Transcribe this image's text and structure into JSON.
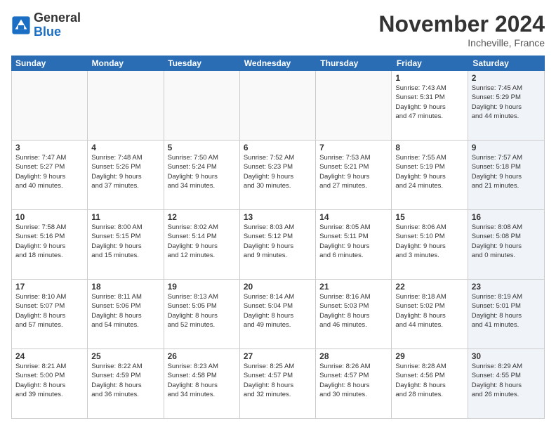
{
  "logo": {
    "text_general": "General",
    "text_blue": "Blue"
  },
  "title": "November 2024",
  "location": "Incheville, France",
  "header_days": [
    "Sunday",
    "Monday",
    "Tuesday",
    "Wednesday",
    "Thursday",
    "Friday",
    "Saturday"
  ],
  "weeks": [
    [
      {
        "day": "",
        "info": ""
      },
      {
        "day": "",
        "info": ""
      },
      {
        "day": "",
        "info": ""
      },
      {
        "day": "",
        "info": ""
      },
      {
        "day": "",
        "info": ""
      },
      {
        "day": "1",
        "info": "Sunrise: 7:43 AM\nSunset: 5:31 PM\nDaylight: 9 hours\nand 47 minutes."
      },
      {
        "day": "2",
        "info": "Sunrise: 7:45 AM\nSunset: 5:29 PM\nDaylight: 9 hours\nand 44 minutes."
      }
    ],
    [
      {
        "day": "3",
        "info": "Sunrise: 7:47 AM\nSunset: 5:27 PM\nDaylight: 9 hours\nand 40 minutes."
      },
      {
        "day": "4",
        "info": "Sunrise: 7:48 AM\nSunset: 5:26 PM\nDaylight: 9 hours\nand 37 minutes."
      },
      {
        "day": "5",
        "info": "Sunrise: 7:50 AM\nSunset: 5:24 PM\nDaylight: 9 hours\nand 34 minutes."
      },
      {
        "day": "6",
        "info": "Sunrise: 7:52 AM\nSunset: 5:23 PM\nDaylight: 9 hours\nand 30 minutes."
      },
      {
        "day": "7",
        "info": "Sunrise: 7:53 AM\nSunset: 5:21 PM\nDaylight: 9 hours\nand 27 minutes."
      },
      {
        "day": "8",
        "info": "Sunrise: 7:55 AM\nSunset: 5:19 PM\nDaylight: 9 hours\nand 24 minutes."
      },
      {
        "day": "9",
        "info": "Sunrise: 7:57 AM\nSunset: 5:18 PM\nDaylight: 9 hours\nand 21 minutes."
      }
    ],
    [
      {
        "day": "10",
        "info": "Sunrise: 7:58 AM\nSunset: 5:16 PM\nDaylight: 9 hours\nand 18 minutes."
      },
      {
        "day": "11",
        "info": "Sunrise: 8:00 AM\nSunset: 5:15 PM\nDaylight: 9 hours\nand 15 minutes."
      },
      {
        "day": "12",
        "info": "Sunrise: 8:02 AM\nSunset: 5:14 PM\nDaylight: 9 hours\nand 12 minutes."
      },
      {
        "day": "13",
        "info": "Sunrise: 8:03 AM\nSunset: 5:12 PM\nDaylight: 9 hours\nand 9 minutes."
      },
      {
        "day": "14",
        "info": "Sunrise: 8:05 AM\nSunset: 5:11 PM\nDaylight: 9 hours\nand 6 minutes."
      },
      {
        "day": "15",
        "info": "Sunrise: 8:06 AM\nSunset: 5:10 PM\nDaylight: 9 hours\nand 3 minutes."
      },
      {
        "day": "16",
        "info": "Sunrise: 8:08 AM\nSunset: 5:08 PM\nDaylight: 9 hours\nand 0 minutes."
      }
    ],
    [
      {
        "day": "17",
        "info": "Sunrise: 8:10 AM\nSunset: 5:07 PM\nDaylight: 8 hours\nand 57 minutes."
      },
      {
        "day": "18",
        "info": "Sunrise: 8:11 AM\nSunset: 5:06 PM\nDaylight: 8 hours\nand 54 minutes."
      },
      {
        "day": "19",
        "info": "Sunrise: 8:13 AM\nSunset: 5:05 PM\nDaylight: 8 hours\nand 52 minutes."
      },
      {
        "day": "20",
        "info": "Sunrise: 8:14 AM\nSunset: 5:04 PM\nDaylight: 8 hours\nand 49 minutes."
      },
      {
        "day": "21",
        "info": "Sunrise: 8:16 AM\nSunset: 5:03 PM\nDaylight: 8 hours\nand 46 minutes."
      },
      {
        "day": "22",
        "info": "Sunrise: 8:18 AM\nSunset: 5:02 PM\nDaylight: 8 hours\nand 44 minutes."
      },
      {
        "day": "23",
        "info": "Sunrise: 8:19 AM\nSunset: 5:01 PM\nDaylight: 8 hours\nand 41 minutes."
      }
    ],
    [
      {
        "day": "24",
        "info": "Sunrise: 8:21 AM\nSunset: 5:00 PM\nDaylight: 8 hours\nand 39 minutes."
      },
      {
        "day": "25",
        "info": "Sunrise: 8:22 AM\nSunset: 4:59 PM\nDaylight: 8 hours\nand 36 minutes."
      },
      {
        "day": "26",
        "info": "Sunrise: 8:23 AM\nSunset: 4:58 PM\nDaylight: 8 hours\nand 34 minutes."
      },
      {
        "day": "27",
        "info": "Sunrise: 8:25 AM\nSunset: 4:57 PM\nDaylight: 8 hours\nand 32 minutes."
      },
      {
        "day": "28",
        "info": "Sunrise: 8:26 AM\nSunset: 4:57 PM\nDaylight: 8 hours\nand 30 minutes."
      },
      {
        "day": "29",
        "info": "Sunrise: 8:28 AM\nSunset: 4:56 PM\nDaylight: 8 hours\nand 28 minutes."
      },
      {
        "day": "30",
        "info": "Sunrise: 8:29 AM\nSunset: 4:55 PM\nDaylight: 8 hours\nand 26 minutes."
      }
    ]
  ]
}
